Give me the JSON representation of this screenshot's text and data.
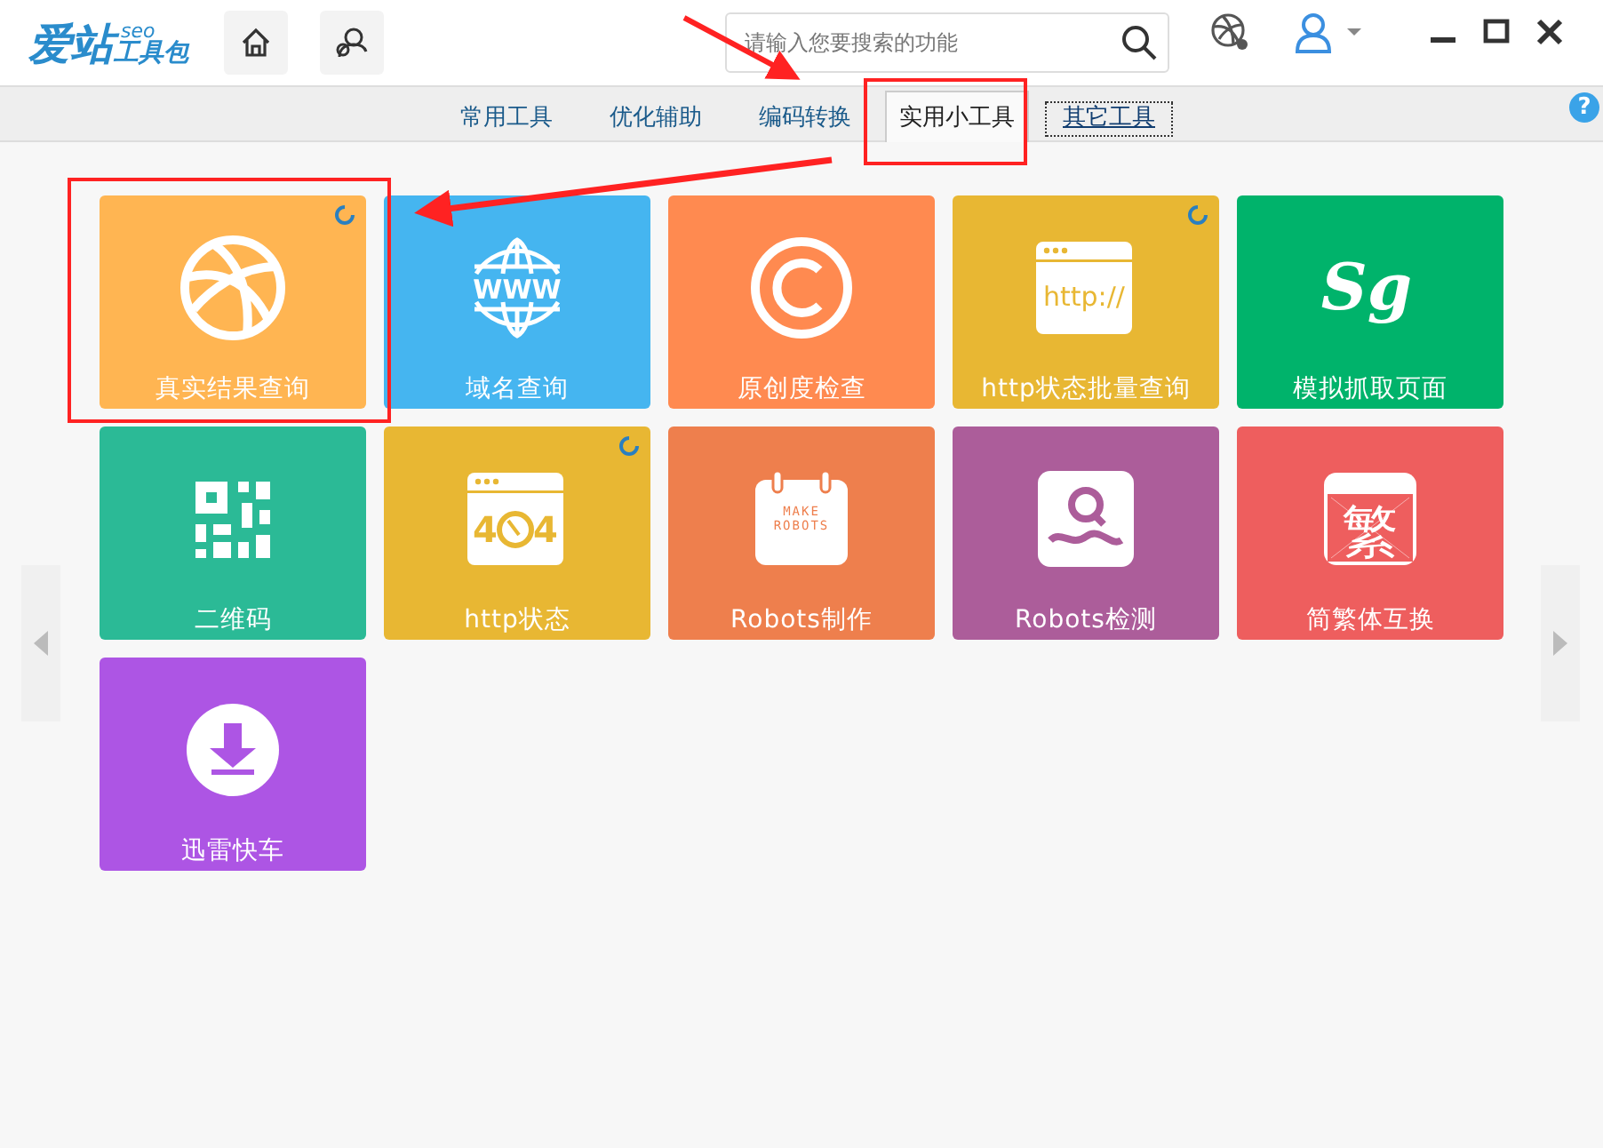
{
  "logo": {
    "main": "爱站",
    "sup": "seo",
    "sub": "工具包"
  },
  "search": {
    "placeholder": "请输入您要搜索的功能"
  },
  "tabs": [
    {
      "label": "常用工具",
      "selected": false,
      "focused": false
    },
    {
      "label": "优化辅助",
      "selected": false,
      "focused": false
    },
    {
      "label": "编码转换",
      "selected": false,
      "focused": false
    },
    {
      "label": "实用小工具",
      "selected": true,
      "focused": false
    },
    {
      "label": "其它工具",
      "selected": false,
      "focused": true
    }
  ],
  "help": "?",
  "tiles": [
    {
      "kind": "ball",
      "label": "真实结果查询",
      "color": "#ffb552",
      "loading": true
    },
    {
      "kind": "www",
      "label": "域名查询",
      "color": "#45b5f0",
      "loading": false,
      "icon_text": [
        "WWW"
      ]
    },
    {
      "kind": "copyright",
      "label": "原创度检查",
      "color": "#ff8a50",
      "loading": false
    },
    {
      "kind": "browser",
      "label": "http状态批量查询",
      "color": "#e8b733",
      "loading": true,
      "icon_text": [
        "http://"
      ]
    },
    {
      "kind": "script",
      "label": "模拟抓取页面",
      "color": "#00b36b",
      "loading": false,
      "icon_text": [
        "Sg"
      ]
    },
    {
      "kind": "qr",
      "label": "二维码",
      "color": "#2bba96",
      "loading": false
    },
    {
      "kind": "notfound",
      "label": "http状态",
      "color": "#e8b733",
      "loading": true,
      "icon_text": [
        "4",
        "4"
      ]
    },
    {
      "kind": "calendar",
      "label": "Robots制作",
      "color": "#ee7f4d",
      "loading": false,
      "icon_text": [
        "MAKE",
        "ROBOTS"
      ]
    },
    {
      "kind": "magnifier",
      "label": "Robots检测",
      "color": "#ac5d9a",
      "loading": false
    },
    {
      "kind": "glyph",
      "label": "简繁体互换",
      "color": "#ee5e5e",
      "loading": false,
      "icon_text": [
        "繁"
      ]
    },
    {
      "kind": "download",
      "label": "迅雷快车",
      "color": "#ad55e4",
      "loading": false
    }
  ]
}
